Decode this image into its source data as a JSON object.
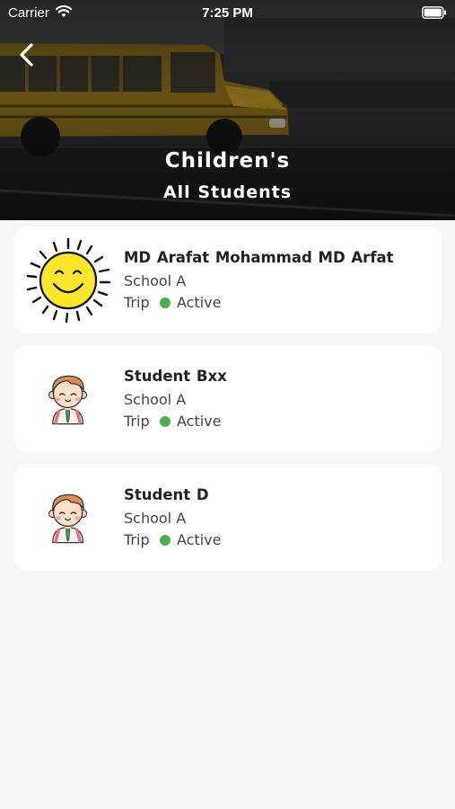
{
  "status_bar": {
    "carrier": "Carrier",
    "time": "7:25 PM",
    "wifi_icon": "wifi-icon",
    "battery_icon": "battery-icon"
  },
  "header": {
    "back_icon": "chevron-left-icon",
    "title": "Children's",
    "subtitle": "All Students"
  },
  "colors": {
    "active_dot": "#4caf50",
    "card_background": "#ffffff",
    "page_background": "#f7f7f7"
  },
  "students": [
    {
      "name": "MD Arafat Mohammad  MD Arfat",
      "school": "School A",
      "trip_label": "Trip",
      "status": "Active",
      "avatar": "sun-smiley-avatar"
    },
    {
      "name": "Student Bxx",
      "school": "School A",
      "trip_label": "Trip",
      "status": "Active",
      "avatar": "boy-cartoon-avatar"
    },
    {
      "name": "Student D",
      "school": "School A",
      "trip_label": "Trip",
      "status": "Active",
      "avatar": "boy-cartoon-avatar"
    }
  ]
}
